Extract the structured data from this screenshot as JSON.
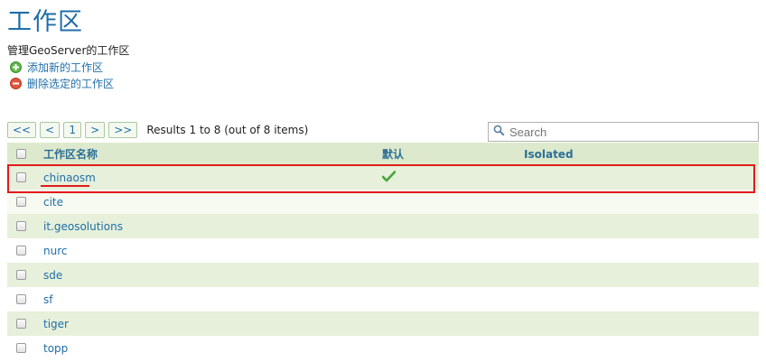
{
  "page": {
    "title": "工作区",
    "description": "管理GeoServer的工作区"
  },
  "actions": {
    "add_label": "添加新的工作区",
    "remove_label": "删除选定的工作区"
  },
  "pager": {
    "first": "<<",
    "prev": "<",
    "current": "1",
    "next": ">",
    "last": ">>",
    "results": "Results 1 to 8 (out of 8 items)"
  },
  "search": {
    "placeholder": "Search"
  },
  "table": {
    "headers": {
      "name": "工作区名称",
      "default": "默认",
      "isolated": "Isolated"
    },
    "rows": [
      {
        "name": "chinaosm",
        "default": true,
        "isolated": false
      },
      {
        "name": "cite",
        "default": false,
        "isolated": false
      },
      {
        "name": "it.geosolutions",
        "default": false,
        "isolated": false
      },
      {
        "name": "nurc",
        "default": false,
        "isolated": false
      },
      {
        "name": "sde",
        "default": false,
        "isolated": false
      },
      {
        "name": "sf",
        "default": false,
        "isolated": false
      },
      {
        "name": "tiger",
        "default": false,
        "isolated": false
      },
      {
        "name": "topp",
        "default": false,
        "isolated": false
      }
    ]
  },
  "colors": {
    "accent": "#1f6ea8",
    "highlight": "#e21b1b",
    "check": "#4aa33a"
  },
  "icons": {
    "add": "plus-circle-icon",
    "remove": "minus-circle-icon",
    "search": "magnifier-icon",
    "default": "checkmark-icon"
  }
}
